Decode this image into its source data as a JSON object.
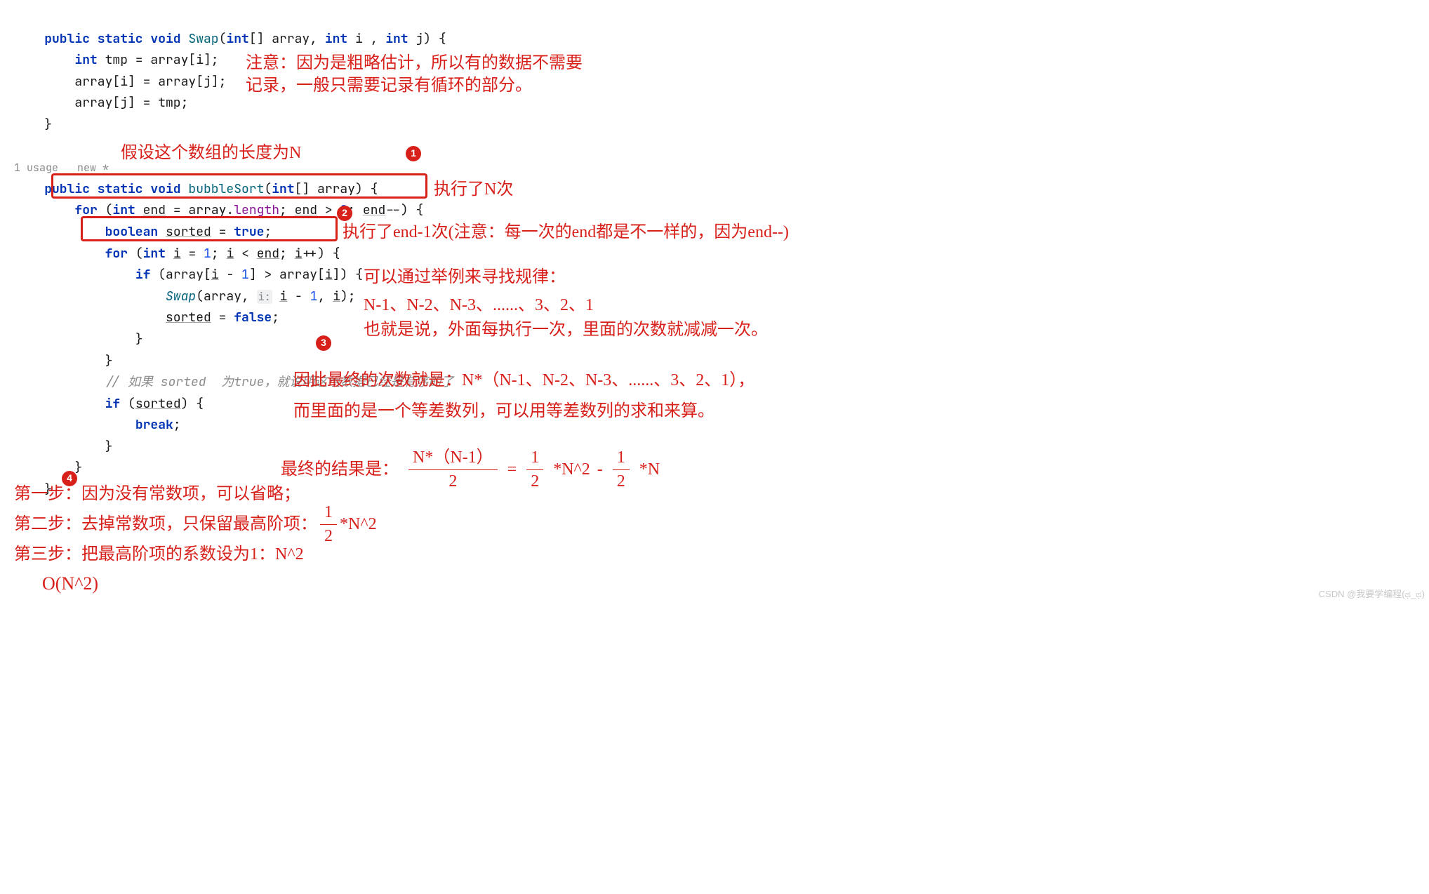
{
  "code": {
    "swap": {
      "l1_pre": "    ",
      "l1_kw1": "public static void ",
      "l1_fn": "Swap",
      "l1_rest": "(",
      "l1_kw2": "int",
      "l1_rest2": "[] array, ",
      "l1_kw3": "int",
      "l1_rest3": " i , ",
      "l1_kw4": "int",
      "l1_rest4": " j) {",
      "l2_pre": "        ",
      "l2_kw": "int",
      "l2_rest": " tmp = array[i];",
      "l3_pre": "        ",
      "l3": "array[i] = array[j];",
      "l4_pre": "        ",
      "l4": "array[j] = tmp;",
      "l5_pre": "    ",
      "l5": "}"
    },
    "meta": "1 usage   new *",
    "bubble": {
      "l1_pre": "    ",
      "l1_kw1": "public static void ",
      "l1_fn": "bubbleSort",
      "l1_rest": "(",
      "l1_kw2": "int",
      "l1_rest2": "[] array) {",
      "l2_pre": "        ",
      "l2_kw": "for ",
      "l2_a": "(",
      "l2_kw2": "int ",
      "l2_var": "end",
      "l2_b": " = array.",
      "l2_prop": "length",
      "l2_c": "; ",
      "l2_var2": "end",
      "l2_d": " > ",
      "l2_lit": "0",
      "l2_e": "; ",
      "l2_var3": "end",
      "l2_f": "--) {",
      "l3_pre": "            ",
      "l3_kw": "boolean ",
      "l3_var": "sorted",
      "l3_rest": " = ",
      "l3_kw2": "true",
      "l3_end": ";",
      "l4_pre": "            ",
      "l4_kw": "for ",
      "l4_a": "(",
      "l4_kw2": "int ",
      "l4_var": "i",
      "l4_b": " = ",
      "l4_lit": "1",
      "l4_c": "; ",
      "l4_var2": "i",
      "l4_d": " < ",
      "l4_var3": "end",
      "l4_e": "; ",
      "l4_var4": "i",
      "l4_f": "++) {",
      "l5_pre": "                ",
      "l5_kw": "if",
      "l5_a": " (array[",
      "l5_var": "i",
      "l5_b": " - ",
      "l5_lit": "1",
      "l5_c": "] > array[",
      "l5_var2": "i",
      "l5_d": "]) {",
      "l6_pre": "                    ",
      "l6_fn": "Swap",
      "l6_a": "(array, ",
      "l6_hint": "i:",
      "l6_sp": " ",
      "l6_var": "i",
      "l6_b": " - ",
      "l6_lit": "1",
      "l6_c": ", ",
      "l6_var2": "i",
      "l6_d": ");",
      "l7_pre": "                    ",
      "l7_var": "sorted",
      "l7_rest": " = ",
      "l7_kw": "false",
      "l7_end": ";",
      "l8_pre": "                ",
      "l8": "}",
      "l9_pre": "            ",
      "l9": "}",
      "l10_pre": "            ",
      "l10_cmt": "// 如果 sorted  为true，就说明这组数据已经是有序的了",
      "l11_pre": "            ",
      "l11_kw": "if",
      "l11_a": " (",
      "l11_var": "sorted",
      "l11_b": ") {",
      "l12_pre": "                ",
      "l12_kw": "break",
      "l12_end": ";",
      "l13_pre": "            ",
      "l13": "}",
      "l14_pre": "        ",
      "l14": "}",
      "l15_pre": "    ",
      "l15": "}"
    }
  },
  "ann": {
    "note_top1": "注意：因为是粗略估计，所以有的数据不需要",
    "note_top2": "记录，一般只需要记录有循环的部分。",
    "assume": "假设这个数组的长度为N",
    "loop1": "执行了N次",
    "loop2": "执行了end-1次(注意：每一次的end都是不一样的，因为end--)",
    "example1": "可以通过举例来寻找规律：",
    "example2": "N-1、N-2、N-3、......、3、2、1",
    "example3": "也就是说，外面每执行一次，里面的次数就减减一次。",
    "therefore1": "因此最终的次数就是：N*（N-1、N-2、N-3、......、3、2、1），",
    "therefore2": "而里面的是一个等差数列，可以用等差数列的求和来算。",
    "final_label": "最终的结果是：",
    "frac1_num": "N*（N-1）",
    "frac1_den": "2",
    "eq": " = ",
    "frac2_num": "1",
    "frac2_den": "2",
    "times_nsq": "*N^2",
    "minus": " - ",
    "frac3_num": "1",
    "frac3_den": "2",
    "times_n": "*N",
    "step1": "第一步：因为没有常数项，可以省略；",
    "step2_pre": "第二步：去掉常数项，只保留最高阶项：",
    "step2_frac_num": "1",
    "step2_frac_den": "2",
    "step2_post": "*N^2",
    "step3": "第三步：把最高阶项的系数设为1：N^2",
    "bigO": "O(N^2)"
  },
  "badges": {
    "b1": "1",
    "b2": "2",
    "b3": "3",
    "b4": "4"
  },
  "watermark": "CSDN @我要学编程(ಥ_ಥ)"
}
